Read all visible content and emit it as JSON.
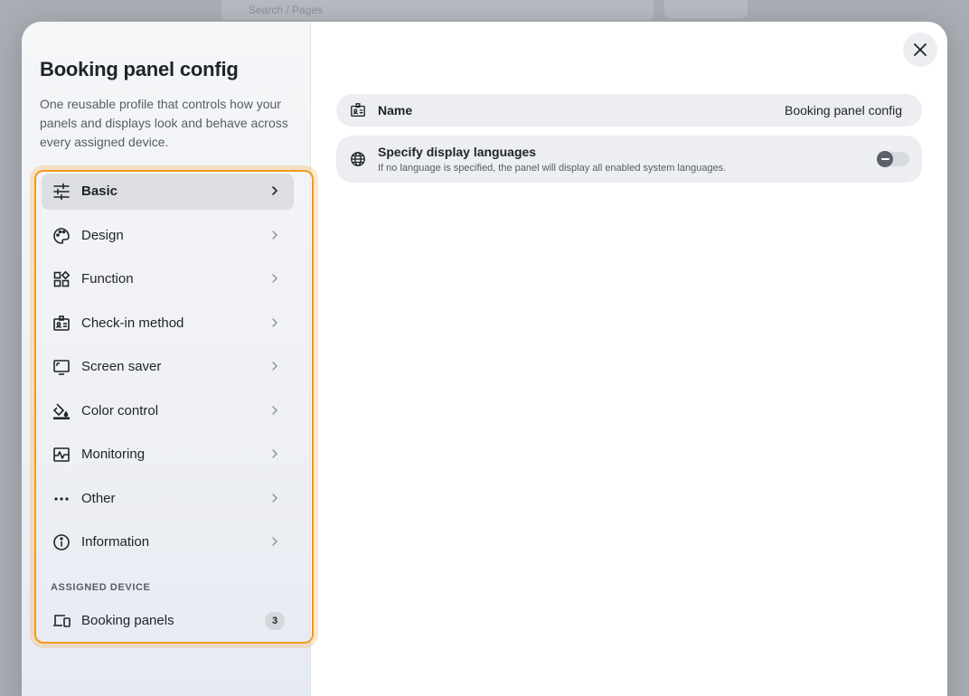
{
  "background": {
    "search_text": "Search / Pages"
  },
  "panel": {
    "title": "Booking panel config",
    "description": "One reusable profile that controls how your panels and displays look and behave across every assigned device."
  },
  "nav": {
    "items": [
      {
        "label": "Basic",
        "icon": "sliders-icon",
        "active": true
      },
      {
        "label": "Design",
        "icon": "palette-icon"
      },
      {
        "label": "Function",
        "icon": "widgets-icon"
      },
      {
        "label": "Check-in method",
        "icon": "id-badge-icon"
      },
      {
        "label": "Screen saver",
        "icon": "monitor-icon"
      },
      {
        "label": "Color control",
        "icon": "paint-bucket-icon"
      },
      {
        "label": "Monitoring",
        "icon": "pulse-icon"
      },
      {
        "label": "Other",
        "icon": "more-dots-icon"
      },
      {
        "label": "Information",
        "icon": "info-icon"
      }
    ],
    "section_label": "ASSIGNED DEVICE",
    "assigned": {
      "label": "Booking panels",
      "icon": "devices-icon",
      "count": "3"
    }
  },
  "settings": {
    "name": {
      "label": "Name",
      "value": "Booking panel config"
    },
    "languages": {
      "label": "Specify display languages",
      "sub": "If no language is specified, the panel will display all enabled system languages.",
      "enabled": false
    }
  },
  "colors": {
    "highlight": "#f39a1e",
    "active_bg": "#dcdee2"
  }
}
